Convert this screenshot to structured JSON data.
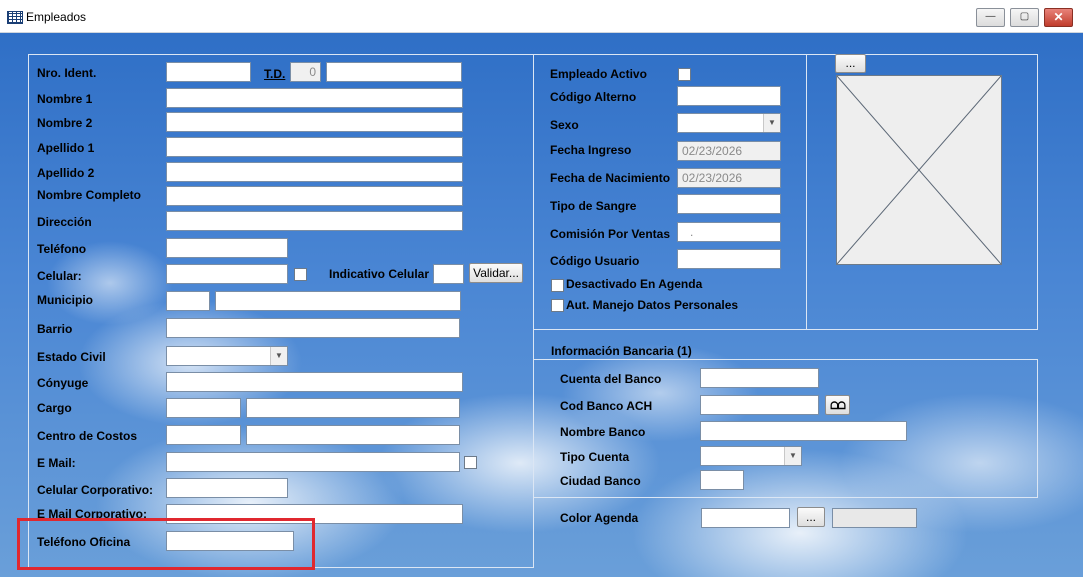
{
  "window": {
    "title": "Empleados",
    "min_label": "—",
    "max_label": "▢",
    "close_label": "✕"
  },
  "left": {
    "nro_ident": "Nro. Ident.",
    "td": "T.D.",
    "td_value": "0",
    "nombre1": "Nombre 1",
    "nombre2": "Nombre 2",
    "apellido1": "Apellido 1",
    "apellido2": "Apellido 2",
    "nombre_completo": "Nombre Completo",
    "direccion": "Dirección",
    "telefono": "Teléfono",
    "celular": "Celular:",
    "indicativo_celular": "Indicativo Celular",
    "validar": "Validar...",
    "municipio": "Municipio",
    "barrio": "Barrio",
    "estado_civil": "Estado Civil",
    "conyuge": "Cónyuge",
    "cargo": "Cargo",
    "centro_costos": "Centro de Costos",
    "email": "E Mail:",
    "celular_corporativo": "Celular Corporativo:",
    "email_corporativo": "E Mail Corporativo:",
    "telefono_oficina": "Teléfono Oficina"
  },
  "mid": {
    "empleado_activo": "Empleado Activo",
    "codigo_alterno": "Código Alterno",
    "sexo": "Sexo",
    "fecha_ingreso": "Fecha Ingreso",
    "fecha_ingreso_value": "02/23/2026",
    "fecha_nacimiento": "Fecha de Nacimiento",
    "fecha_nacimiento_value": "02/23/2026",
    "tipo_sangre": "Tipo de Sangre",
    "comision_ventas": "Comisión Por Ventas",
    "comision_value": ".",
    "codigo_usuario": "Código Usuario",
    "desactivado_agenda": "Desactivado En Agenda",
    "aut_manejo": "Aut. Manejo Datos Personales"
  },
  "photo": {
    "browse_label": "..."
  },
  "bank": {
    "title": "Información Bancaria (1)",
    "cuenta": "Cuenta del Banco",
    "cod_banco": "Cod Banco ACH",
    "nombre_banco": "Nombre Banco",
    "tipo_cuenta": "Tipo Cuenta",
    "ciudad_banco": "Ciudad Banco"
  },
  "agenda": {
    "color_agenda": "Color Agenda",
    "browse_label": "..."
  },
  "colors": {
    "highlight": "#e0282f",
    "sky": "#4a86d4"
  }
}
